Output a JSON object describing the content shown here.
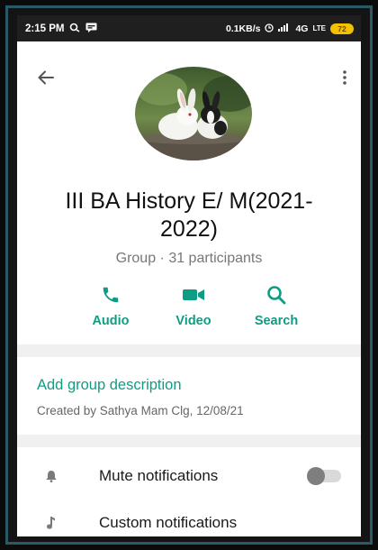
{
  "status_bar": {
    "time": "2:15 PM",
    "network_speed": "0.1KB/s",
    "network_type": "4G",
    "lte_label": "LTE",
    "battery": "72"
  },
  "header": {
    "back_icon": "arrow-left-icon",
    "menu_icon": "more-vertical-icon"
  },
  "group": {
    "name": "III BA History E/ M(2021-2022)",
    "meta": "Group · 31 participants"
  },
  "actions": [
    {
      "label": "Audio",
      "icon": "phone-icon"
    },
    {
      "label": "Video",
      "icon": "video-camera-icon"
    },
    {
      "label": "Search",
      "icon": "search-icon"
    }
  ],
  "description": {
    "add_label": "Add group description",
    "created_by": "Created by Sathya Mam Clg, 12/08/21"
  },
  "settings": [
    {
      "label": "Mute notifications",
      "icon": "bell-icon",
      "toggle_on": false
    },
    {
      "label": "Custom notifications",
      "icon": "music-note-icon"
    }
  ],
  "colors": {
    "accent": "#0e9d84",
    "status_bar": "#1f1f1f",
    "battery": "#f2c200"
  }
}
